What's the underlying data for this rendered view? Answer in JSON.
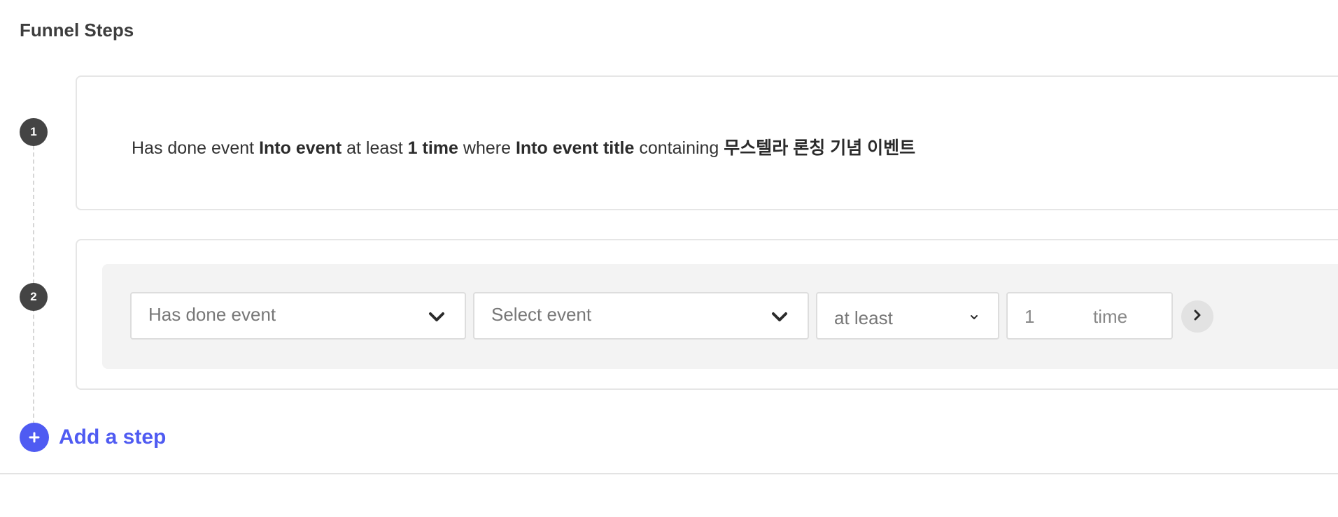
{
  "section": {
    "title": "Funnel Steps"
  },
  "steps": [
    {
      "number": "1",
      "summary": {
        "prefix": "Has done event",
        "event_name": "Into event",
        "frequency": "at least",
        "count_label": "1 time",
        "where_word": "where",
        "property_name": "Into event title",
        "operator": "containing",
        "property_value": "무스텔라 론칭 기념 이벤트"
      }
    },
    {
      "number": "2",
      "editor": {
        "event_type_value": "Has done event",
        "event_placeholder": "Select event",
        "frequency_value": "at least",
        "count_value": "1",
        "count_unit": "time"
      }
    }
  ],
  "add_step": {
    "label": "Add a step"
  },
  "icons": {
    "chevron": "chevron-down-icon",
    "next": "chevron-right-icon",
    "add": "plus-icon"
  },
  "colors": {
    "accent": "#4f5bf2",
    "badge": "#444444",
    "editor_bg": "#f3f3f3"
  }
}
